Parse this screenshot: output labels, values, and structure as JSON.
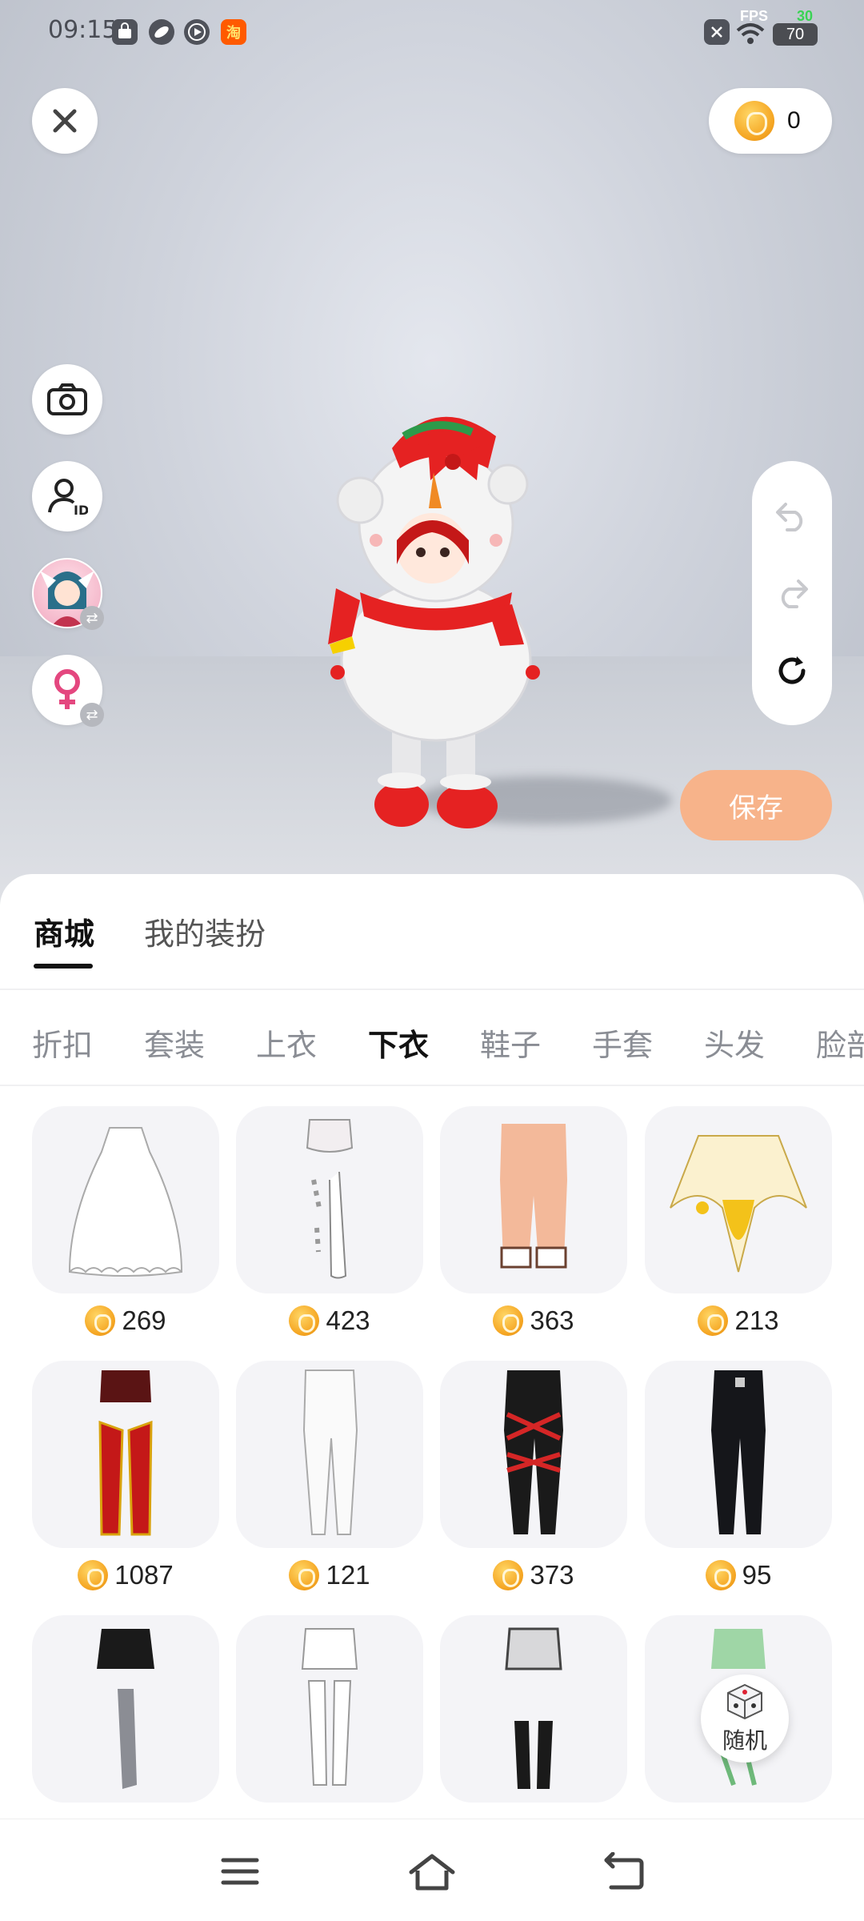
{
  "status_bar": {
    "time": "09:15",
    "fps_label": "FPS",
    "fps_value": "30",
    "battery": "70",
    "icons": [
      "shopping-bag-icon",
      "leaf-icon",
      "play-icon",
      "taobao-icon",
      "close-box-icon",
      "wifi-icon"
    ]
  },
  "header": {
    "close_icon": "close-icon",
    "coin_balance": "0"
  },
  "side_tools": [
    {
      "name": "camera",
      "icon": "camera-icon"
    },
    {
      "name": "user-id",
      "icon": "user-id-icon"
    },
    {
      "name": "switch-avatar",
      "icon": "avatar-thumbnail"
    },
    {
      "name": "switch-gender",
      "icon": "female-icon"
    }
  ],
  "history_controls": [
    "undo-icon",
    "redo-icon",
    "reset-icon"
  ],
  "save_label": "保存",
  "main_tabs": [
    {
      "label": "商城",
      "active": true
    },
    {
      "label": "我的装扮",
      "active": false
    }
  ],
  "categories": [
    {
      "label": "折扣",
      "active": false
    },
    {
      "label": "套装",
      "active": false
    },
    {
      "label": "上衣",
      "active": false
    },
    {
      "label": "下衣",
      "active": true
    },
    {
      "label": "鞋子",
      "active": false
    },
    {
      "label": "手套",
      "active": false
    },
    {
      "label": "头发",
      "active": false
    },
    {
      "label": "脸部",
      "active": false
    }
  ],
  "items": [
    {
      "kind": "white-lace-dress",
      "price": "269"
    },
    {
      "kind": "shorts-with-lace-stockings",
      "price": "423"
    },
    {
      "kind": "peach-pants-with-lace",
      "price": "363"
    },
    {
      "kind": "banana-skirt",
      "price": "213"
    },
    {
      "kind": "red-armor-leggings",
      "price": "1087"
    },
    {
      "kind": "white-leggings",
      "price": "121"
    },
    {
      "kind": "black-red-laced-pants",
      "price": "373"
    },
    {
      "kind": "black-jeans",
      "price": "95"
    },
    {
      "kind": "black-skirt-gradient-stocking",
      "price": ""
    },
    {
      "kind": "white-shorts-stockings",
      "price": ""
    },
    {
      "kind": "grey-shorts-black-socks",
      "price": ""
    },
    {
      "kind": "green-shorts",
      "price": ""
    }
  ],
  "random_label": "随机",
  "colors": {
    "accent_save": "#f7b38a",
    "coin": "#f5a623",
    "female": "#e4477f",
    "active_tab": "#111111",
    "inactive_tab": "#8a8d94"
  },
  "nav": [
    "menu-icon",
    "home-icon",
    "back-icon"
  ]
}
